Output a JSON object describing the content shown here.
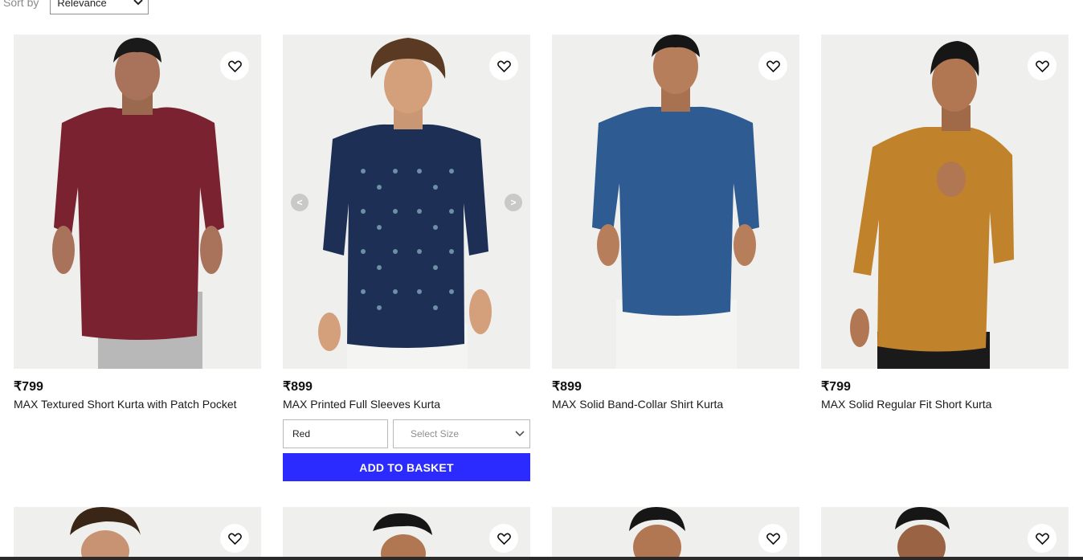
{
  "sort": {
    "label": "Sort by",
    "value": "Relevance"
  },
  "products": [
    {
      "price": "₹799",
      "title": "MAX Textured Short Kurta with Patch Pocket",
      "color": "#7a2230"
    },
    {
      "price": "₹899",
      "title": "MAX Printed Full Sleeves Kurta",
      "color": "#1d2f55"
    },
    {
      "price": "₹899",
      "title": "MAX Solid Band-Collar Shirt Kurta",
      "color": "#2e5b92"
    },
    {
      "price": "₹799",
      "title": "MAX Solid Regular Fit Short Kurta",
      "color": "#c0822a"
    }
  ],
  "hovered": {
    "color_value": "Red",
    "size_placeholder": "Select Size",
    "add_button": "ADD TO BASKET",
    "prev": "<",
    "next": ">"
  },
  "colors": {
    "accent": "#2b2bff",
    "image_bg": "#efefed"
  }
}
